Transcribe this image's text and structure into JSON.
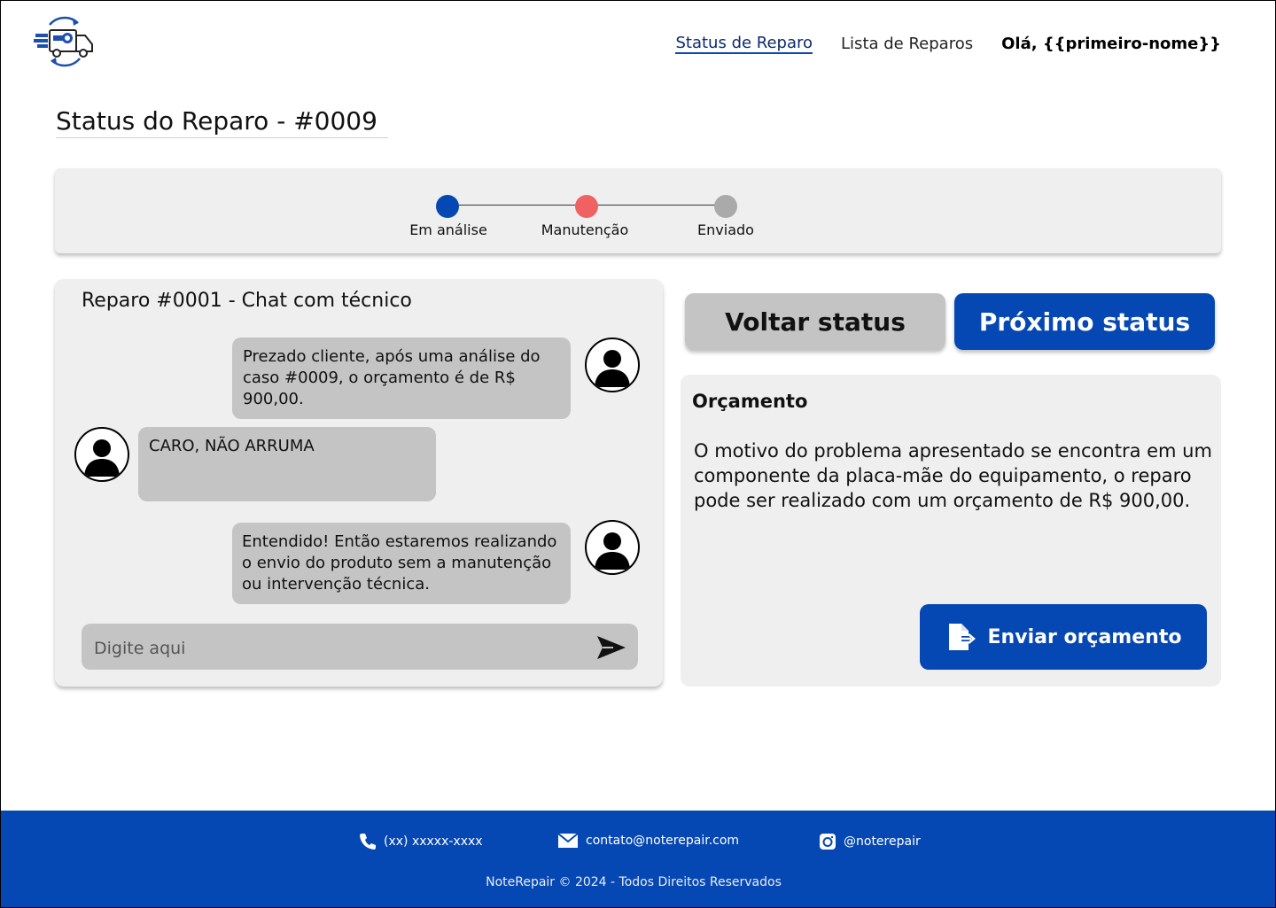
{
  "header": {
    "logo": "notebook-repair-truck-logo",
    "nav": {
      "status_link": "Status de Reparo",
      "list_link": "Lista de Reparos",
      "greeting": "Olá, {{primeiro-nome}}"
    }
  },
  "page": {
    "title": "Status do Reparo - #0009"
  },
  "progress": {
    "steps": [
      {
        "label": "Em análise",
        "color": "#0648b3"
      },
      {
        "label": "Manutenção",
        "color": "#f06262"
      },
      {
        "label": "Enviado",
        "color": "#aaaaaa"
      }
    ]
  },
  "chat": {
    "title": "Reparo #0001 - Chat com técnico",
    "messages": [
      {
        "from": "technician",
        "text": "Prezado cliente, após uma análise do caso #0009, o orçamento é de R$ 900,00."
      },
      {
        "from": "client",
        "text": "CARO, NÃO ARRUMA"
      },
      {
        "from": "technician",
        "text": "Entendido! Então estaremos realizando o envio do produto sem a manutenção ou intervenção técnica."
      }
    ],
    "input_placeholder": "Digite aqui",
    "send_icon": "send-icon"
  },
  "actions": {
    "back_label": "Voltar status",
    "next_label": "Próximo status"
  },
  "budget": {
    "title": "Orçamento",
    "text": "O motivo do problema apresentado se encontra em um componente da placa-mãe do equipamento, o reparo pode ser realizado com um orçamento de R$ 900,00.",
    "send_label": "Enviar orçamento",
    "send_icon": "file-export-icon"
  },
  "footer": {
    "phone": "(xx) xxxxx-xxxx",
    "email": "contato@noterepair.com",
    "instagram": "@noterepair",
    "copyright": "NoteRepair © 2024 - Todos Direitos Reservados"
  },
  "colors": {
    "primary": "#0648b3",
    "panel": "#f0eff0",
    "bubble": "#c4c4c4"
  }
}
